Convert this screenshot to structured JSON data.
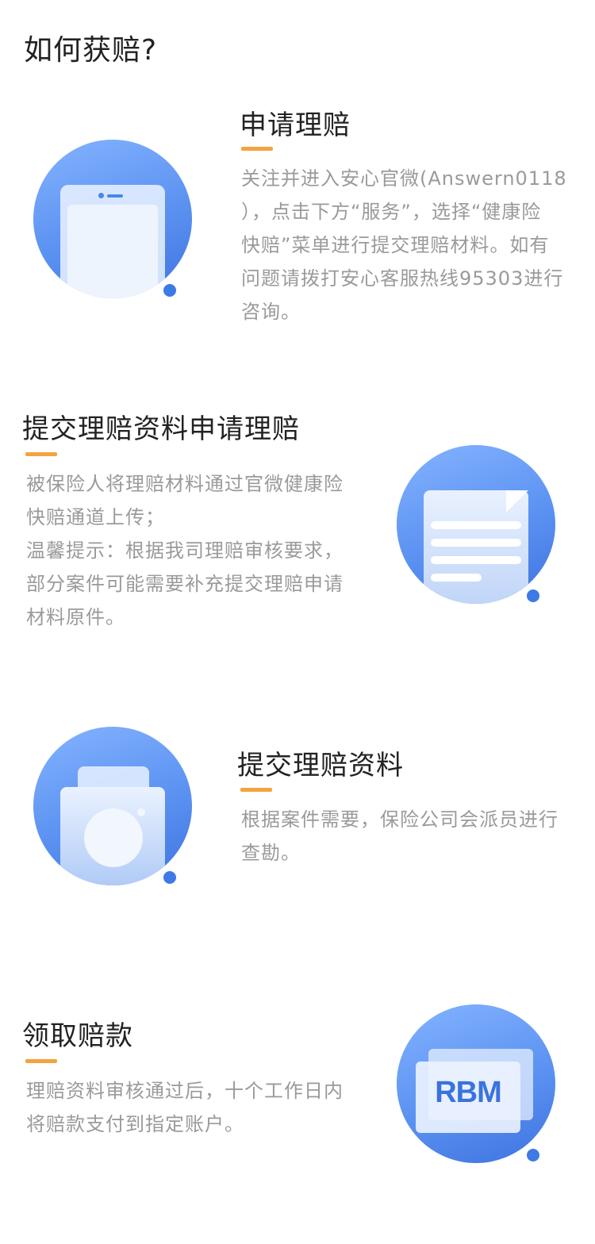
{
  "page": {
    "title": "如何获赔?"
  },
  "steps": [
    {
      "title": "申请理赔",
      "icon": "phone-icon",
      "desc": [
        "关注并进入安心官微(Answern0118",
        "），点击下方“服务”，选择“健康险",
        "快赔”菜单进行提交理赔材料。如有",
        "问题请拨打安心客服热线95303进行",
        "咨询。"
      ]
    },
    {
      "title": "提交理赔资料申请理赔",
      "icon": "document-icon",
      "desc": [
        "被保险人将理赔材料通过官微健康险",
        "快赔通道上传；",
        "温馨提示：根据我司理赔审核要求，",
        "部分案件可能需要补充提交理赔申请",
        "材料原件。"
      ]
    },
    {
      "title": "提交理赔资料",
      "icon": "camera-icon",
      "desc": [
        "根据案件需要，保险公司会派员进行",
        "查勘。"
      ]
    },
    {
      "title": "领取赔款",
      "icon": "bank-card-icon",
      "card_text": "RBM",
      "desc": [
        "理赔资料审核通过后，十个工作日内",
        "将赔款支付到指定账户。"
      ]
    }
  ],
  "colors": {
    "accent": "#f4a340",
    "icon_blue": "#5b92f1",
    "dot_blue": "#3d7ae5",
    "title_text": "#222222",
    "desc_text": "#9a9a9a"
  }
}
